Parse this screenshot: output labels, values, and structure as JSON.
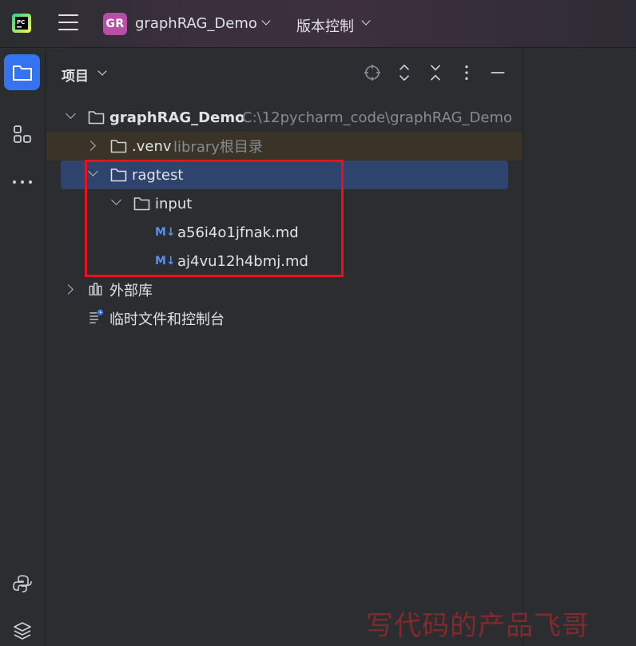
{
  "titlebar": {
    "project_badge": "GR",
    "project_name": "graphRAG_Demo",
    "vcs_label": "版本控制",
    "icons": [
      "pycharm-logo-icon",
      "hamburger-menu-icon",
      "chevron-down-icon"
    ]
  },
  "strip": {
    "icons": [
      "folder-icon",
      "structure-icon",
      "more-icon",
      "python-console-icon",
      "layers-icon"
    ]
  },
  "panel": {
    "title": "项目",
    "tools": [
      "locate-icon",
      "expand-all-icon",
      "collapse-all-icon",
      "more-vertical-icon",
      "minimize-icon"
    ]
  },
  "tree": {
    "root": {
      "name": "graphRAG_Demo",
      "path": "C:\\12pycharm_code\\graphRAG_Demo"
    },
    "venv": {
      "name": ".venv",
      "hint": "library根目录"
    },
    "ragtest": {
      "name": "ragtest"
    },
    "input": {
      "name": "input"
    },
    "files": [
      {
        "badge": "M↓",
        "name": "a56i4o1jfnak.md"
      },
      {
        "badge": "M↓",
        "name": "aj4vu12h4bmj.md"
      }
    ],
    "external_libs": "外部库",
    "scratches": "临时文件和控制台"
  },
  "watermark": "写代码的产品飞哥",
  "colors": {
    "accent": "#3574f0",
    "selection": "#2e436e",
    "highlight_box": "#e8121f",
    "project_badge": "#b84fa6"
  }
}
